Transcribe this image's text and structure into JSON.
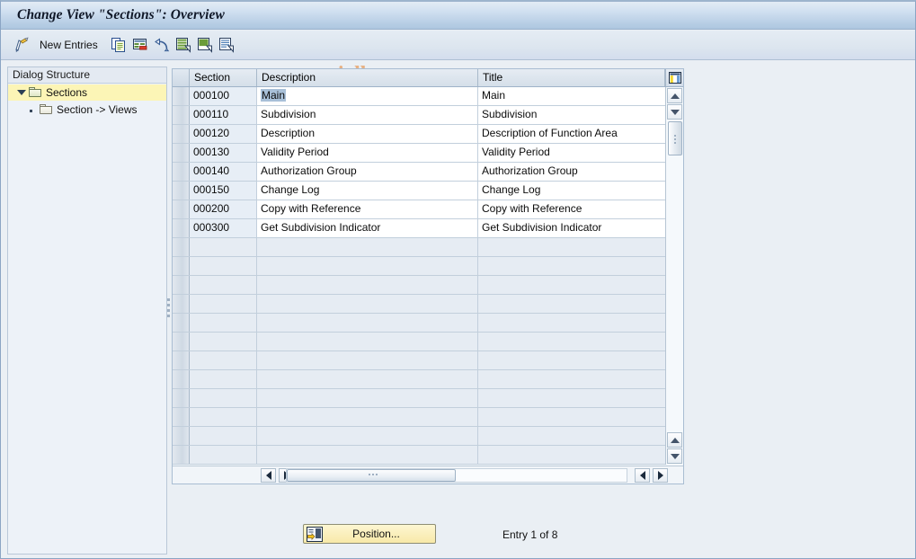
{
  "window": {
    "title": "Change View \"Sections\": Overview"
  },
  "toolbar": {
    "items": [
      {
        "name": "display-change-icon",
        "label": "",
        "icon": "pencil-paper-icon"
      },
      {
        "name": "new-entries-button",
        "label": "New Entries",
        "icon": ""
      },
      {
        "name": "copy-as-icon",
        "label": "",
        "icon": "copy-icon"
      },
      {
        "name": "delete-icon",
        "label": "",
        "icon": "delete-row-icon"
      },
      {
        "name": "undo-icon",
        "label": "",
        "icon": "undo-arrow-icon"
      },
      {
        "name": "select-all-icon",
        "label": "",
        "icon": "select-all-icon"
      },
      {
        "name": "deselect-all-icon",
        "label": "",
        "icon": "deselect-all-icon"
      },
      {
        "name": "variant-icon",
        "label": "",
        "icon": "details-icon"
      }
    ],
    "watermark": "www.tutorialkart.com"
  },
  "sidebar": {
    "header": "Dialog Structure",
    "items": [
      {
        "label": "Sections",
        "selected": true,
        "level": 0,
        "expanded": true
      },
      {
        "label": "Section -> Views",
        "selected": false,
        "level": 1,
        "expanded": false
      }
    ]
  },
  "table": {
    "columns": [
      {
        "key": "section",
        "label": "Section"
      },
      {
        "key": "description",
        "label": "Description"
      },
      {
        "key": "title",
        "label": "Title"
      }
    ],
    "rows": [
      {
        "section": "000100",
        "description": "Main",
        "title": "Main",
        "selected_cell": "description"
      },
      {
        "section": "000110",
        "description": "Subdivision",
        "title": "Subdivision"
      },
      {
        "section": "000120",
        "description": "Description",
        "title": "Description of Function Area"
      },
      {
        "section": "000130",
        "description": "Validity Period",
        "title": "Validity Period"
      },
      {
        "section": "000140",
        "description": "Authorization Group",
        "title": "Authorization Group"
      },
      {
        "section": "000150",
        "description": "Change Log",
        "title": "Change Log"
      },
      {
        "section": "000200",
        "description": "Copy with Reference",
        "title": "Copy with Reference"
      },
      {
        "section": "000300",
        "description": "Get Subdivision Indicator",
        "title": "Get Subdivision Indicator"
      }
    ],
    "empty_row_count": 12,
    "config_icon": "table-settings-icon"
  },
  "footer": {
    "position_button": "Position...",
    "position_icon": "position-jump-icon",
    "entry_status": "Entry 1 of 8"
  }
}
